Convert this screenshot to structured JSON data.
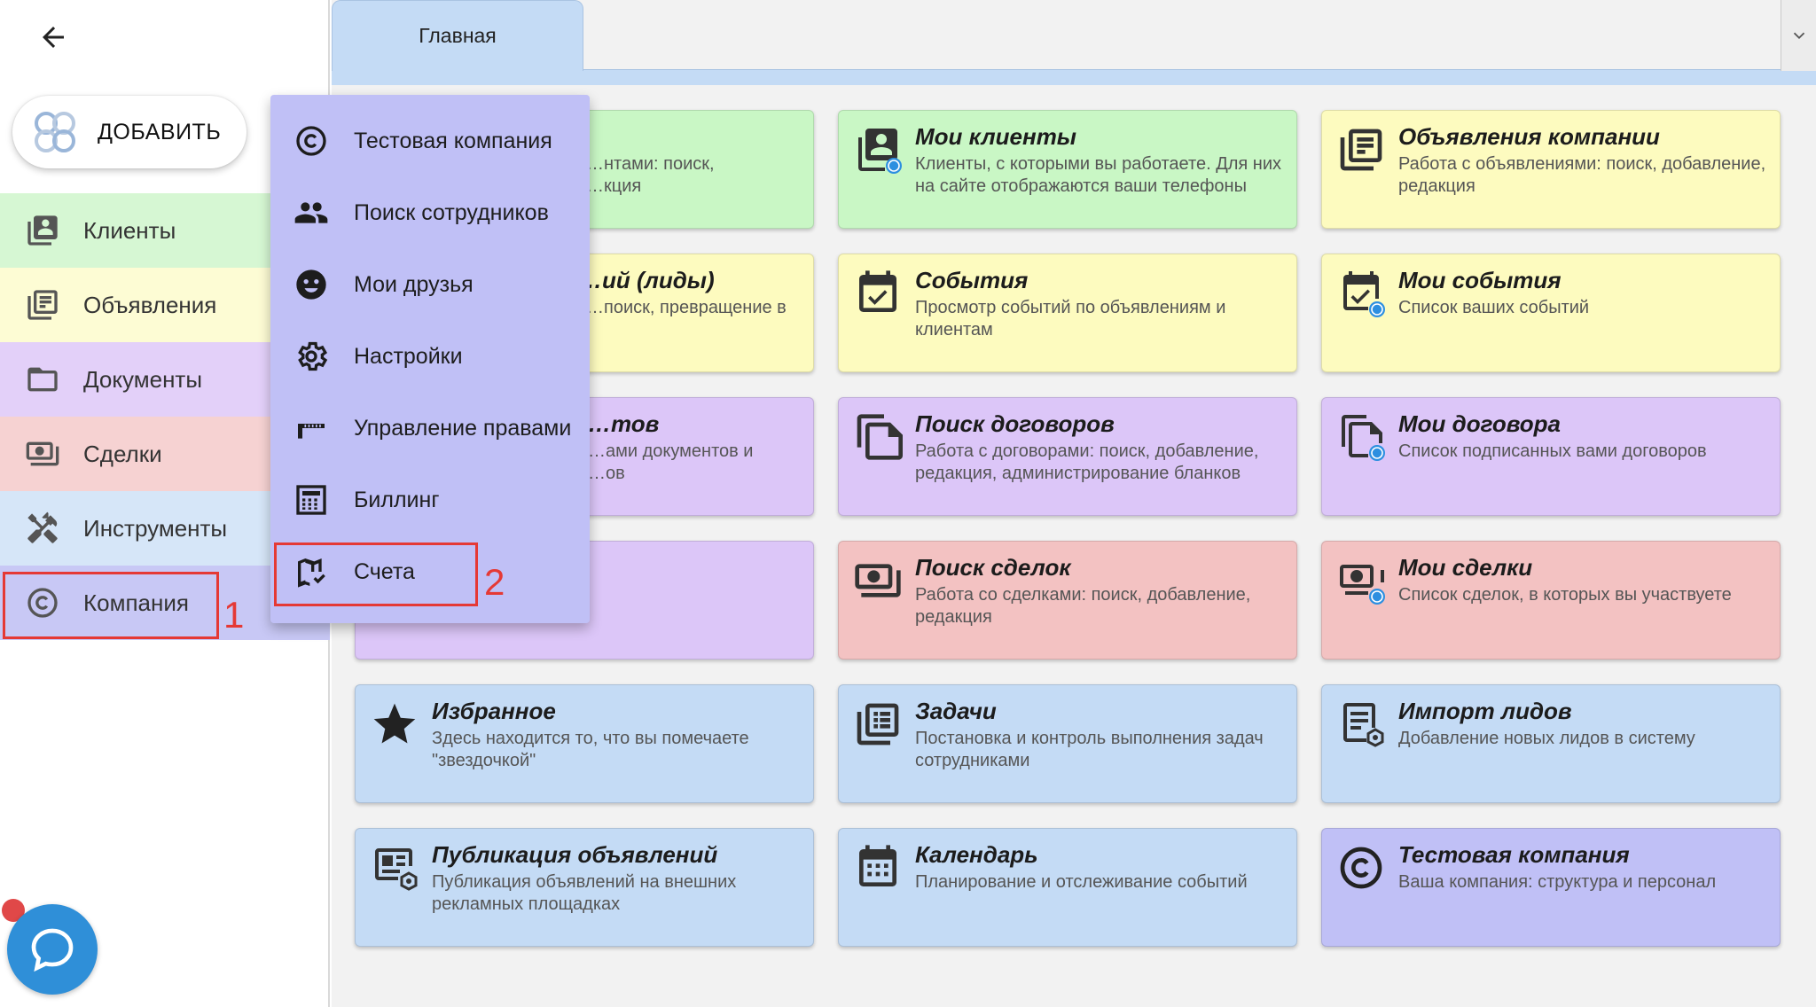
{
  "sidebar": {
    "add_label": "ДОБАВИТЬ",
    "items": [
      {
        "label": "Клиенты",
        "icon": "clients-icon",
        "color": "#d6f7d3"
      },
      {
        "label": "Объявления",
        "icon": "ads-icon",
        "color": "#fdfcd4"
      },
      {
        "label": "Документы",
        "icon": "folder-icon",
        "color": "#e3d0f9"
      },
      {
        "label": "Сделки",
        "icon": "deals-icon",
        "color": "#f6d2d2"
      },
      {
        "label": "Инструменты",
        "icon": "tools-icon",
        "color": "#d6e6f8"
      },
      {
        "label": "Компания",
        "icon": "copyright-icon",
        "color": "#c8c8f5"
      }
    ]
  },
  "tabs": {
    "home_label": "Главная"
  },
  "menu": {
    "items": [
      {
        "label": "Тестовая компания",
        "icon": "copyright-icon"
      },
      {
        "label": "Поиск сотрудников",
        "icon": "people-icon"
      },
      {
        "label": "Мои друзья",
        "icon": "smiley-icon"
      },
      {
        "label": "Настройки",
        "icon": "gear-icon"
      },
      {
        "label": "Управление правами",
        "icon": "gate-icon"
      },
      {
        "label": "Биллинг",
        "icon": "calculator-icon"
      },
      {
        "label": "Счета",
        "icon": "map-check-icon"
      }
    ]
  },
  "annotations": {
    "step1": "1",
    "step2": "2"
  },
  "cards": [
    {
      "title": "",
      "desc": "…нтами: поиск,\n…кция",
      "color": "green"
    },
    {
      "title": "Мои клиенты",
      "desc": "Клиенты, с которыми вы работаете. Для них на сайте отображаются ваши телефоны",
      "color": "green"
    },
    {
      "title": "Объявления компании",
      "desc": "Работа с объявлениями: поиск, добавление, редакция",
      "color": "yellow"
    },
    {
      "title": "…ий (лиды)",
      "desc": "…поиск, превращение в",
      "color": "yellow"
    },
    {
      "title": "События",
      "desc": "Просмотр событий по объявлениям и клиентам",
      "color": "yellow"
    },
    {
      "title": "Мои события",
      "desc": "Список ваших событий",
      "color": "yellow"
    },
    {
      "title": "…тов",
      "desc": "…ами документов и\n…ов",
      "color": "purple"
    },
    {
      "title": "Поиск договоров",
      "desc": "Работа с договорами: поиск, добавление, редакция, администрирование бланков",
      "color": "purple"
    },
    {
      "title": "Мои договора",
      "desc": "Список подписанных вами договоров",
      "color": "purple"
    },
    {
      "title": "",
      "desc": "",
      "color": "purple"
    },
    {
      "title": "Поиск сделок",
      "desc": "Работа со сделками: поиск, добавление, редакция",
      "color": "red"
    },
    {
      "title": "Мои сделки",
      "desc": "Список сделок, в которых вы участвуете",
      "color": "red"
    },
    {
      "title": "Избранное",
      "desc": "Здесь находится то, что вы помечаете \"звездочкой\"",
      "color": "blue"
    },
    {
      "title": "Задачи",
      "desc": "Постановка и контроль выполнения задач сотрудниками",
      "color": "blue"
    },
    {
      "title": "Импорт лидов",
      "desc": "Добавление новых лидов в систему",
      "color": "blue"
    },
    {
      "title": "Публикация объявлений",
      "desc": "Публикация объявлений на внешних рекламных площадках",
      "color": "blue"
    },
    {
      "title": "Календарь",
      "desc": "Планирование и отслеживание событий",
      "color": "blue"
    },
    {
      "title": "Тестовая компания",
      "desc": "Ваша компания: структура и персонал",
      "color": "indigo"
    }
  ]
}
